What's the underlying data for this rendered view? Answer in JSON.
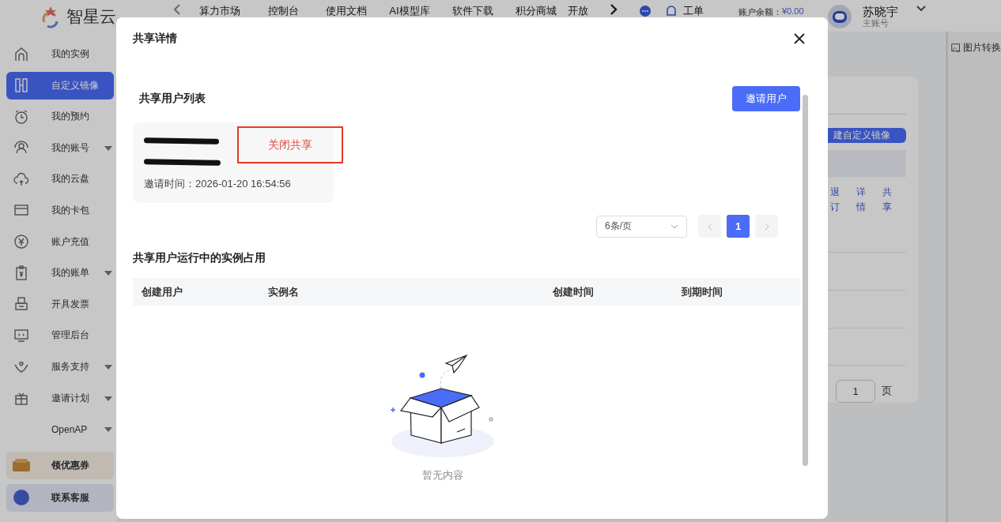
{
  "header": {
    "logo": "智星云",
    "nav": [
      "算力市场",
      "控制台",
      "使用文档",
      "AI模型库",
      "软件下载",
      "积分商城",
      "开放"
    ],
    "ticket": "工单",
    "balance_label": "账户余额：",
    "balance_value": "¥0.00",
    "user_name": "苏晓宇",
    "user_role": "主账号"
  },
  "sidebar": {
    "items": [
      {
        "label": "我的实例",
        "selected": false,
        "expandable": false
      },
      {
        "label": "自定义镜像",
        "selected": true,
        "expandable": false
      },
      {
        "label": "我的预约",
        "selected": false,
        "expandable": false
      },
      {
        "label": "我的账号",
        "selected": false,
        "expandable": true
      },
      {
        "label": "我的云盘",
        "selected": false,
        "expandable": false
      },
      {
        "label": "我的卡包",
        "selected": false,
        "expandable": false
      },
      {
        "label": "账户充值",
        "selected": false,
        "expandable": false
      },
      {
        "label": "我的账单",
        "selected": false,
        "expandable": true
      },
      {
        "label": "开具发票",
        "selected": false,
        "expandable": false
      },
      {
        "label": "管理后台",
        "selected": false,
        "expandable": false
      },
      {
        "label": "服务支持",
        "selected": false,
        "expandable": true
      },
      {
        "label": "邀请计划",
        "selected": false,
        "expandable": true
      },
      {
        "label": "OpenAP",
        "selected": false,
        "expandable": true
      }
    ],
    "promos": [
      {
        "label": "领优惠券"
      },
      {
        "label": "联系客服"
      }
    ]
  },
  "background": {
    "create_button": "建自定义镜像",
    "actions": [
      "退订",
      "详情",
      "共享"
    ],
    "page_input": "1",
    "page_suffix": "页"
  },
  "side_panel": {
    "item": "图片转换"
  },
  "modal": {
    "title": "共享详情",
    "share_section": {
      "title": "共享用户列表",
      "invite_button": "邀请用户",
      "shares": [
        {
          "invited": "邀请时间：2026-01-20 16:54:56",
          "action": "关闭共享"
        }
      ],
      "pagination": {
        "page_size": "6条/页",
        "pages": [
          {
            "label": "1",
            "selected": true
          }
        ]
      }
    },
    "instance_section": {
      "title": "共享用户运行中的实例占用",
      "columns": [
        "创建用户",
        "实例名",
        "创建时间",
        "到期时间"
      ],
      "empty_text": "暂无内容"
    }
  }
}
